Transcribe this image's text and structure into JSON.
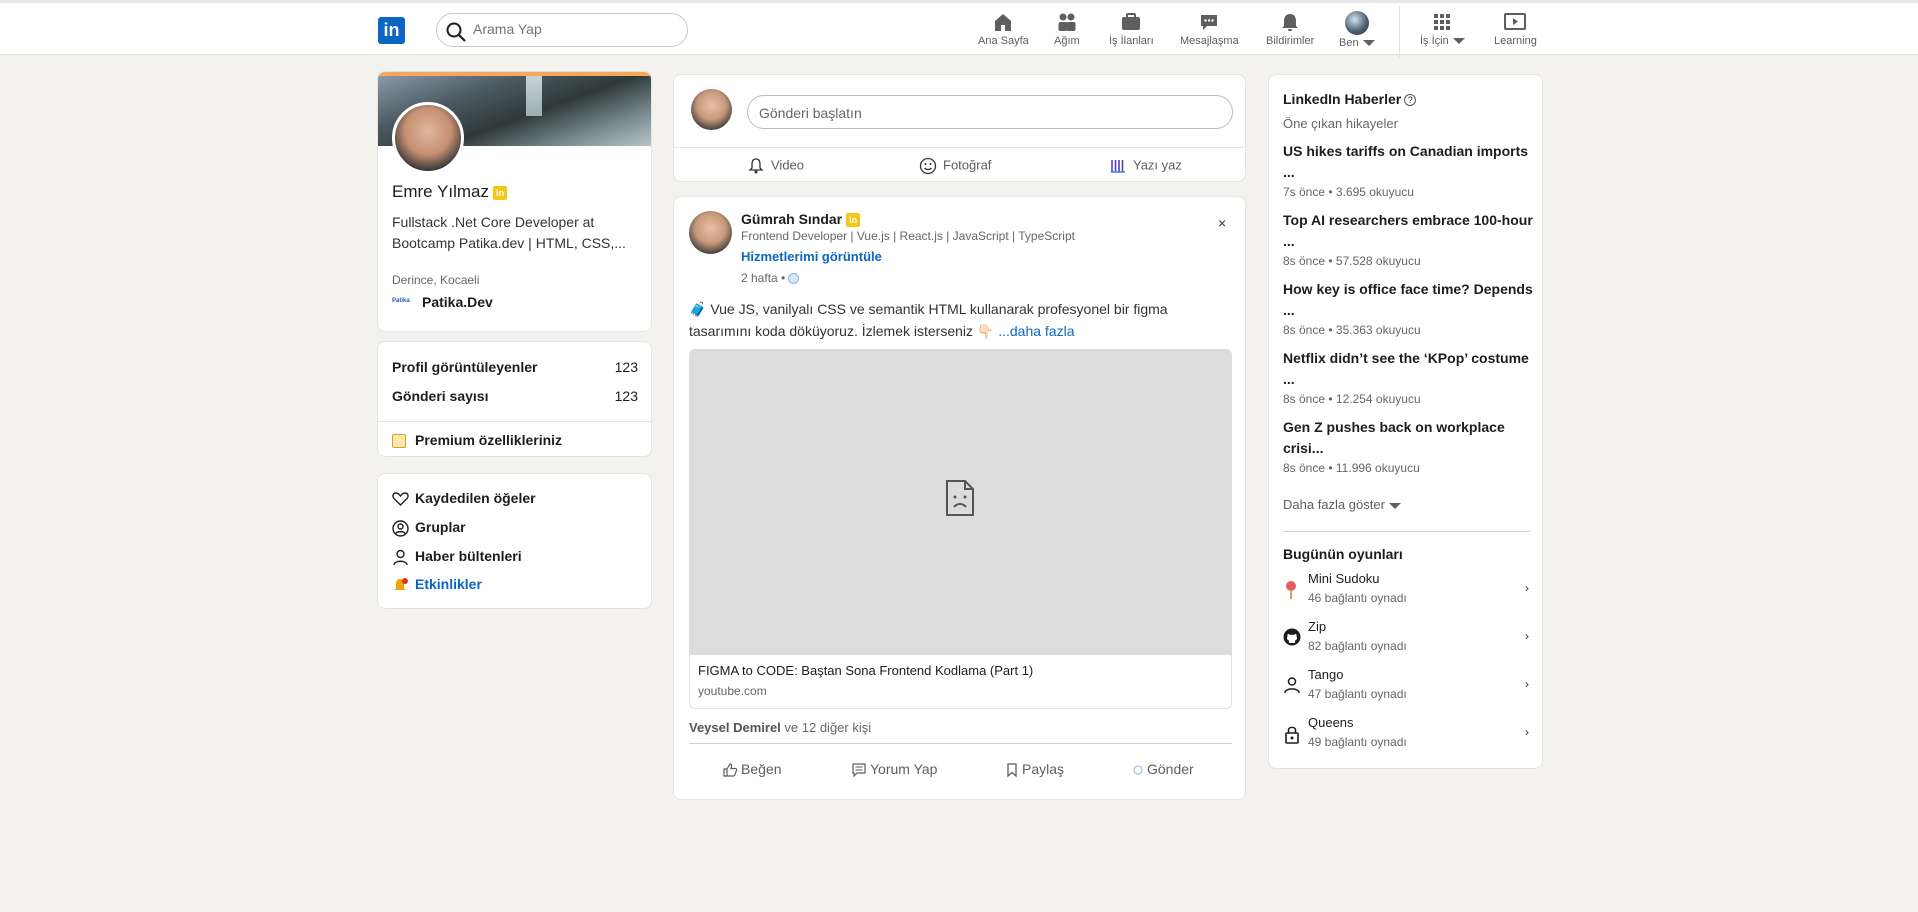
{
  "nav": {
    "logo": "in",
    "search_placeholder": "Arama Yap",
    "items": [
      {
        "label": "Ana Sayfa"
      },
      {
        "label": "Ağım"
      },
      {
        "label": "İş İlanları"
      },
      {
        "label": "Mesajlaşma"
      },
      {
        "label": "Bildirimler"
      },
      {
        "label": "Ben"
      },
      {
        "label": "İş İçin"
      },
      {
        "label": "Learning"
      }
    ]
  },
  "profile": {
    "name": "Emre Yılmaz",
    "badge": "in",
    "headline": "Fullstack .Net Core Developer at Bootcamp Patika.dev | HTML, CSS,...",
    "location": "Derince, Kocaeli",
    "company_logo": "Patika",
    "company": "Patika.Dev"
  },
  "stats": {
    "rows": [
      {
        "label": "Profil görüntüleyenler",
        "value": "123"
      },
      {
        "label": "Gönderi sayısı",
        "value": "123"
      }
    ],
    "premium": "Premium özellikleriniz"
  },
  "links": {
    "items": [
      {
        "label": "Kaydedilen öğeler",
        "icon": "heart-icon"
      },
      {
        "label": "Gruplar",
        "icon": "group-icon"
      },
      {
        "label": "Haber bültenleri",
        "icon": "person-icon"
      },
      {
        "label": "Etkinlikler",
        "icon": "bell-icon"
      }
    ]
  },
  "compose": {
    "placeholder": "Gönderi başlatın",
    "actions": [
      {
        "label": "Video"
      },
      {
        "label": "Fotoğraf"
      },
      {
        "label": "Yazı yaz"
      }
    ]
  },
  "post": {
    "author": "Gümrah Sındar",
    "badge": "in",
    "title": "Frontend Developer | Vue.js | React.js | JavaScript | TypeScript",
    "services": "Hizmetlerimi görüntüle",
    "time": "2 hafta •",
    "close": "×",
    "text": "🧳 Vue JS, vanilyalı CSS ve semantik HTML kullanarak profesyonel bir figma tasarımını koda döküyoruz. İzlemek isterseniz 👇🏻 ",
    "more": "...daha fazla",
    "media_title": "FIGMA to CODE: Baştan Sona Frontend Kodlama (Part 1)",
    "media_domain": "youtube.com",
    "reactions_name": "Veysel Demirel",
    "reactions_rest": " ve 12 diğer kişi",
    "actions": [
      {
        "label": "Beğen"
      },
      {
        "label": "Yorum Yap"
      },
      {
        "label": "Paylaş"
      },
      {
        "label": "Gönder"
      }
    ]
  },
  "news": {
    "title": "LinkedIn Haberler",
    "subtitle": "Öne çıkan hikayeler",
    "items": [
      {
        "title": "US hikes tariffs on Canadian imports ...",
        "meta": "7s önce • 3.695 okuyucu"
      },
      {
        "title": "Top AI researchers embrace 100-hour ...",
        "meta": "8s önce • 57.528 okuyucu"
      },
      {
        "title": "How key is office face time? Depends ...",
        "meta": "8s önce • 35.363 okuyucu"
      },
      {
        "title": "Netflix didn’t see the ‘KPop’ costume ...",
        "meta": "8s önce • 12.254 okuyucu"
      },
      {
        "title": "Gen Z pushes back on workplace crisi...",
        "meta": "8s önce • 11.996 okuyucu"
      }
    ],
    "show_more": "Daha fazla göster",
    "games_title": "Bugünün oyunları",
    "games": [
      {
        "name": "Mini Sudoku",
        "meta": "46 bağlantı oynadı",
        "icon": "pin-icon"
      },
      {
        "name": "Zip",
        "meta": "82 bağlantı oynadı",
        "icon": "github-icon"
      },
      {
        "name": "Tango",
        "meta": "47 bağlantı oynadı",
        "icon": "person-icon"
      },
      {
        "name": "Queens",
        "meta": "49 bağlantı oynadı",
        "icon": "lock-icon"
      }
    ],
    "chevron": "›"
  },
  "colors": {
    "brand": "#0a66c2",
    "background": "#f4f2ee",
    "premium_gold": "#f5c518"
  }
}
